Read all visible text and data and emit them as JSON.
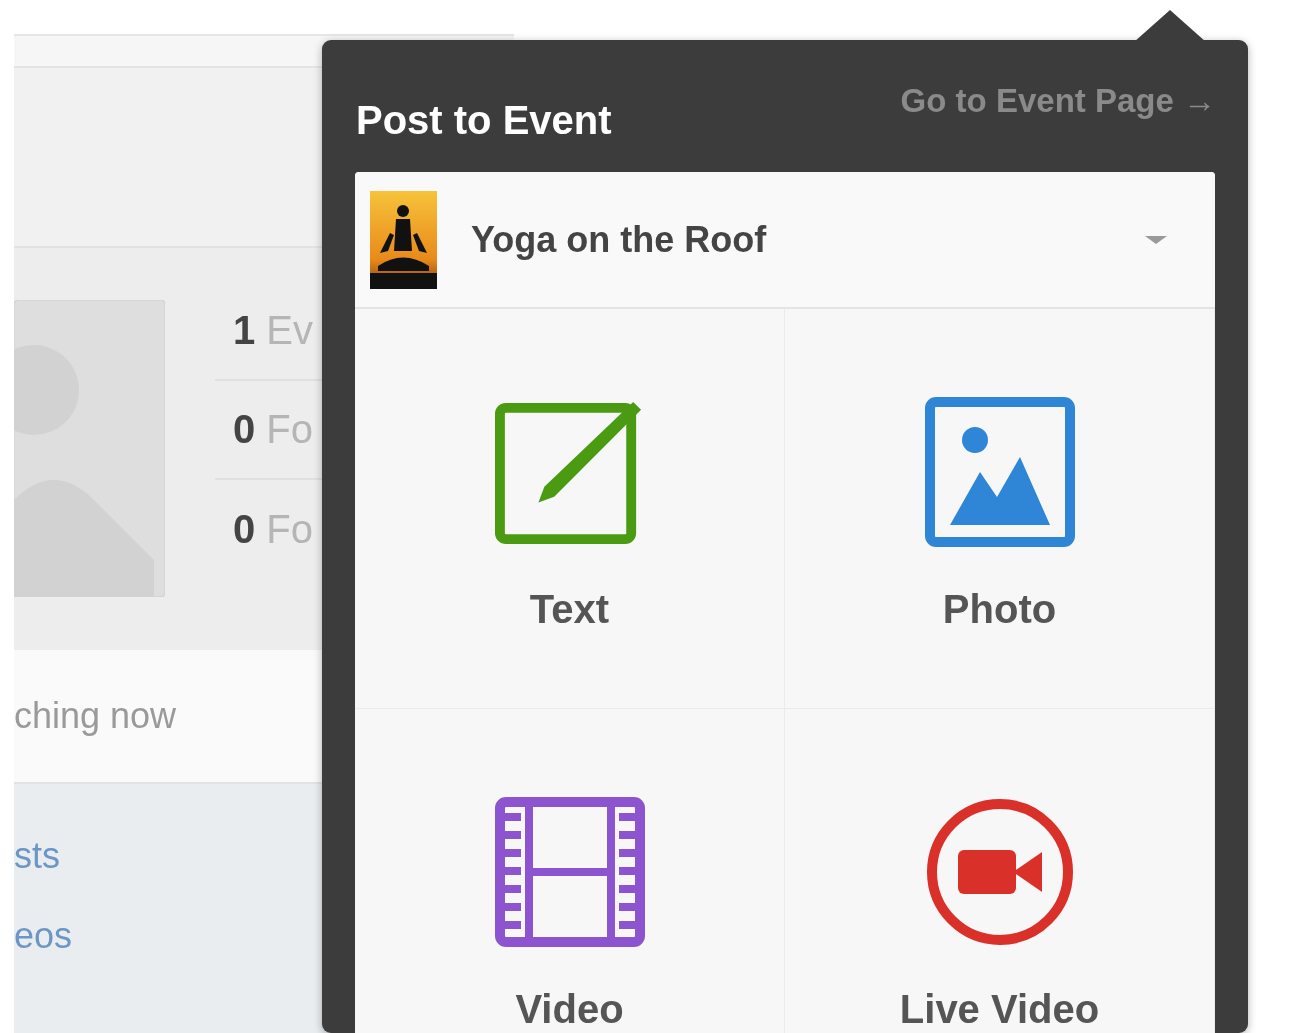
{
  "page": {
    "stats": [
      {
        "count": "1",
        "label": "Ev"
      },
      {
        "count": "0",
        "label": "Fo"
      },
      {
        "count": "0",
        "label": "Fo"
      }
    ],
    "watching": "ching now",
    "links": [
      "sts",
      "eos"
    ]
  },
  "popup": {
    "title": "Post to Event",
    "link": "Go to Event Page →",
    "event": "Yoga on the Roof",
    "options": [
      {
        "kind": "text",
        "label": "Text"
      },
      {
        "label": "Photo"
      },
      {
        "kind": "video",
        "label": "Video"
      },
      {
        "kind": "live",
        "label": "Live Video"
      }
    ]
  }
}
